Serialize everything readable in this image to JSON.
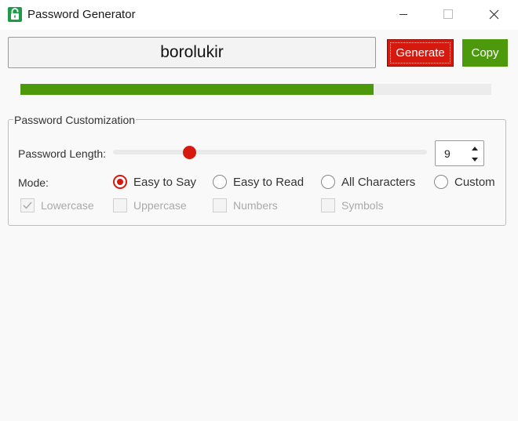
{
  "window": {
    "title": "Password Generator",
    "icon": "lock-icon",
    "controls": [
      "minimize-icon",
      "maximize-icon",
      "close-icon"
    ]
  },
  "password": {
    "value": "borolukir"
  },
  "buttons": {
    "generate_label": "Generate",
    "copy_label": "Copy"
  },
  "strength": {
    "percent": 75
  },
  "customization": {
    "legend": "Password Customization",
    "length_label": "Password Length:",
    "length_value": "9",
    "length_slider": {
      "value": 9,
      "min": 4,
      "max": 40
    },
    "mode_label": "Mode:",
    "modes": [
      {
        "label": "Easy to Say",
        "checked": true
      },
      {
        "label": "Easy to Read",
        "checked": false
      },
      {
        "label": "All Characters",
        "checked": false
      },
      {
        "label": "Custom",
        "checked": false
      }
    ],
    "options": [
      {
        "label": "Lowercase",
        "checked": true,
        "enabled": false
      },
      {
        "label": "Uppercase",
        "checked": false,
        "enabled": false
      },
      {
        "label": "Numbers",
        "checked": false,
        "enabled": false
      },
      {
        "label": "Symbols",
        "checked": false,
        "enabled": false
      }
    ]
  },
  "colors": {
    "accent_red": "#d5190f",
    "accent_green": "#4c9a0b",
    "background": "#f9f9f9"
  }
}
